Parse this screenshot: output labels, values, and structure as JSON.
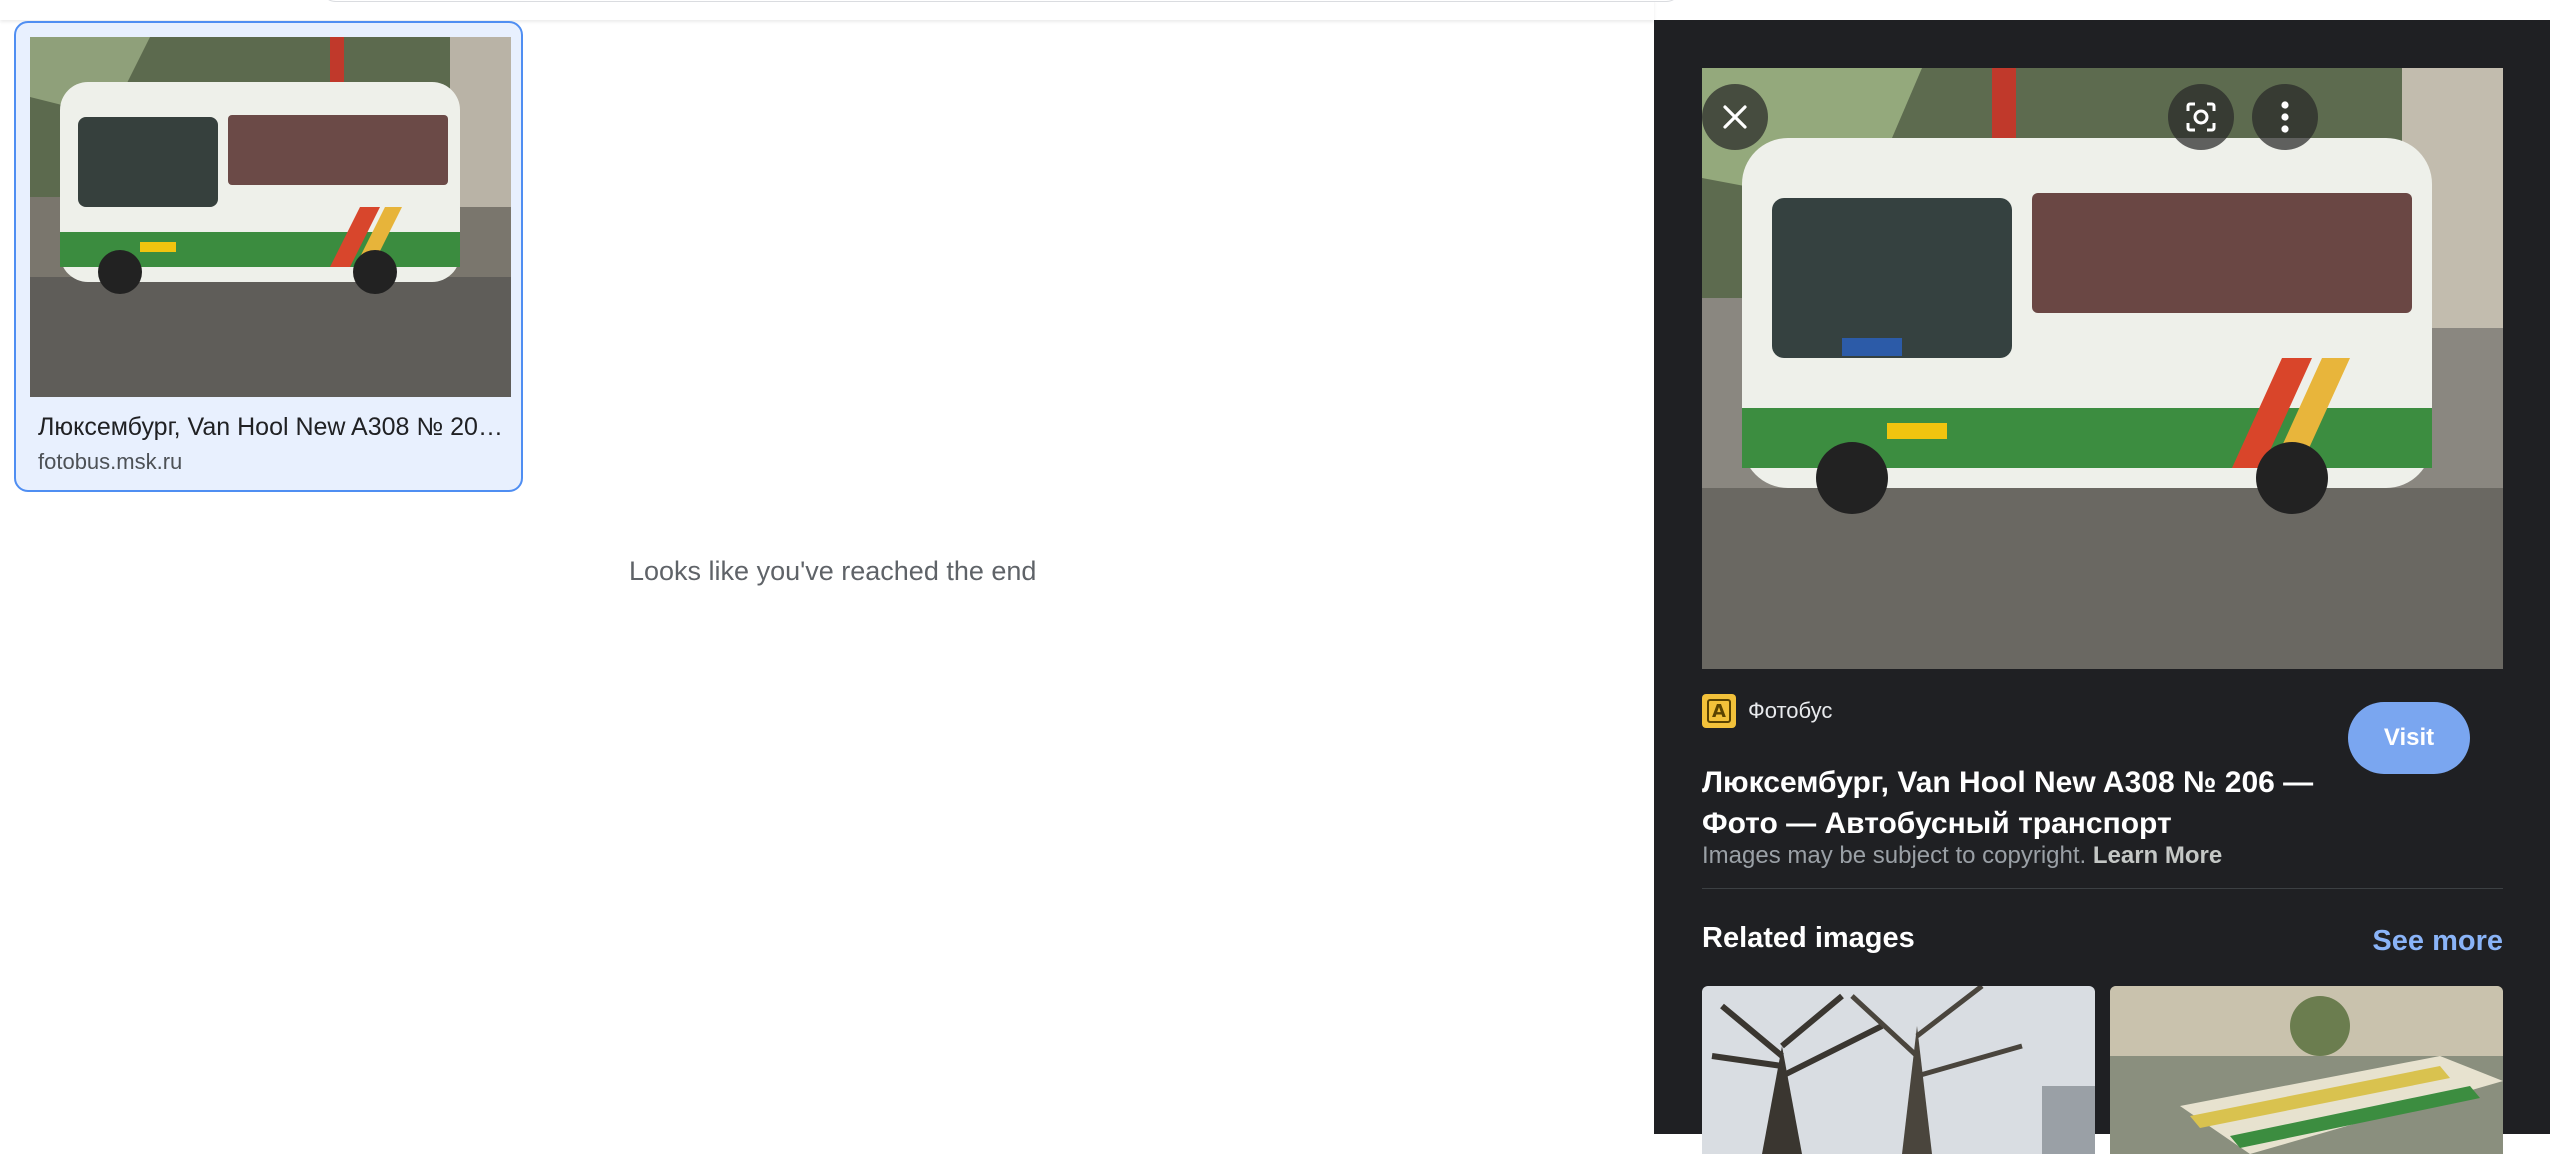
{
  "results": {
    "card": {
      "title": "Люксембург, Van Hool New A308 № 20…",
      "source": "fotobus.msk.ru"
    },
    "end_message": "Looks like you've reached the end"
  },
  "panel": {
    "source_name": "Фотобус",
    "favicon_letter": "A",
    "title": "Люксембург, Van Hool New A308 № 206 — Фото — Автобусный транспорт",
    "visit_label": "Visit",
    "copyright_text": "Images may be subject to copyright.",
    "learn_more_label": "Learn More",
    "related_title": "Related images",
    "see_more_label": "See more",
    "icons": {
      "close": "close-icon",
      "lens": "lens-icon",
      "more": "more-vert-icon"
    }
  },
  "colors": {
    "accent_blue": "#4f8ef2",
    "panel_bg": "#1f2023",
    "visit_bg": "#7aa6f0",
    "link": "#8ab4f8"
  }
}
